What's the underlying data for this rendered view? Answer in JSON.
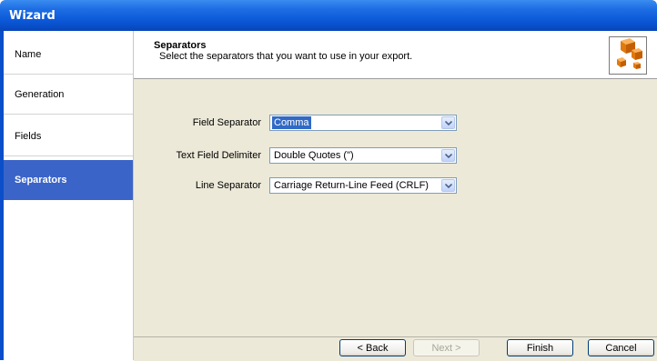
{
  "window": {
    "title": "Wizard"
  },
  "sidebar": {
    "items": [
      {
        "label": "Name"
      },
      {
        "label": "Generation"
      },
      {
        "label": "Fields"
      },
      {
        "label": "Separators"
      }
    ],
    "active_index": 3
  },
  "header": {
    "title": "Separators",
    "description": "Select the separators that you want to use in your export.",
    "icon": "orange-cubes-icon"
  },
  "form": {
    "field_separator": {
      "label": "Field Separator",
      "value": "Comma"
    },
    "text_delimiter": {
      "label": "Text Field Delimiter",
      "value": "Double Quotes (\")"
    },
    "line_separator": {
      "label": "Line Separator",
      "value": "Carriage Return-Line Feed (CRLF)"
    }
  },
  "buttons": {
    "back": "< Back",
    "next": "Next >",
    "finish": "Finish",
    "cancel": "Cancel"
  },
  "colors": {
    "title_bar": "#0a56d6",
    "sidebar_active": "#3b64c8",
    "panel": "#ece9d8",
    "focus_highlight": "#316ac5"
  }
}
